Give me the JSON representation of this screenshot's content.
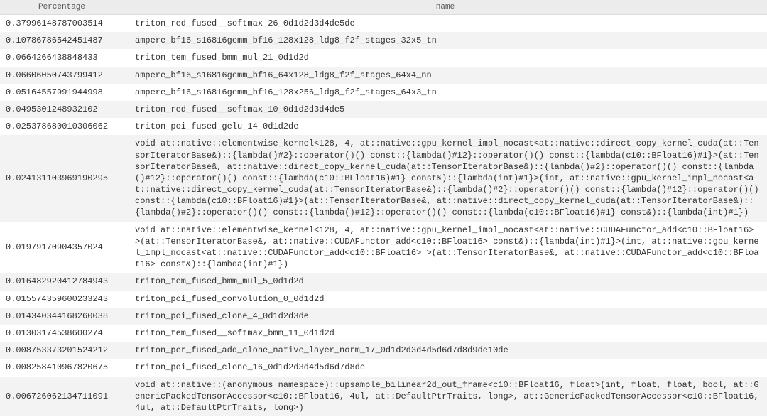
{
  "columns": {
    "percentage": "Percentage",
    "name": "name"
  },
  "rows": [
    {
      "percentage": "0.37996148787003514",
      "name": "triton_red_fused__softmax_26_0d1d2d3d4de5de"
    },
    {
      "percentage": "0.10786786542451487",
      "name": "ampere_bf16_s16816gemm_bf16_128x128_ldg8_f2f_stages_32x5_tn"
    },
    {
      "percentage": "0.0664266438848433",
      "name": "triton_tem_fused_bmm_mul_21_0d1d2d"
    },
    {
      "percentage": "0.06606050743799412",
      "name": "ampere_bf16_s16816gemm_bf16_64x128_ldg8_f2f_stages_64x4_nn"
    },
    {
      "percentage": "0.05164557991944998",
      "name": "ampere_bf16_s16816gemm_bf16_128x256_ldg8_f2f_stages_64x3_tn"
    },
    {
      "percentage": "0.0495301248932102",
      "name": "triton_red_fused__softmax_10_0d1d2d3d4de5"
    },
    {
      "percentage": "0.025378680010306062",
      "name": "triton_poi_fused_gelu_14_0d1d2de"
    },
    {
      "percentage": "0.024131103969190295",
      "name": "void at::native::elementwise_kernel<128, 4, at::native::gpu_kernel_impl_nocast<at::native::direct_copy_kernel_cuda(at::TensorIteratorBase&)::{lambda()#2}::operator()() const::{lambda()#12}::operator()() const::{lambda(c10::BFloat16)#1}>(at::TensorIteratorBase&, at::native::direct_copy_kernel_cuda(at::TensorIteratorBase&)::{lambda()#2}::operator()() const::{lambda()#12}::operator()() const::{lambda(c10::BFloat16)#1} const&)::{lambda(int)#1}>(int, at::native::gpu_kernel_impl_nocast<at::native::direct_copy_kernel_cuda(at::TensorIteratorBase&)::{lambda()#2}::operator()() const::{lambda()#12}::operator()() const::{lambda(c10::BFloat16)#1}>(at::TensorIteratorBase&, at::native::direct_copy_kernel_cuda(at::TensorIteratorBase&)::{lambda()#2}::operator()() const::{lambda()#12}::operator()() const::{lambda(c10::BFloat16)#1} const&)::{lambda(int)#1})"
    },
    {
      "percentage": "0.01979170904357024",
      "name": "void at::native::elementwise_kernel<128, 4, at::native::gpu_kernel_impl_nocast<at::native::CUDAFunctor_add<c10::BFloat16> >(at::TensorIteratorBase&, at::native::CUDAFunctor_add<c10::BFloat16> const&)::{lambda(int)#1}>(int, at::native::gpu_kernel_impl_nocast<at::native::CUDAFunctor_add<c10::BFloat16> >(at::TensorIteratorBase&, at::native::CUDAFunctor_add<c10::BFloat16> const&)::{lambda(int)#1})"
    },
    {
      "percentage": "0.016482920412784943",
      "name": "triton_tem_fused_bmm_mul_5_0d1d2d"
    },
    {
      "percentage": "0.015574359600233243",
      "name": "triton_poi_fused_convolution_0_0d1d2d"
    },
    {
      "percentage": "0.014340344168260038",
      "name": "triton_poi_fused_clone_4_0d1d2d3de"
    },
    {
      "percentage": "0.01303174538600274",
      "name": "triton_tem_fused__softmax_bmm_11_0d1d2d"
    },
    {
      "percentage": "0.008753373201524212",
      "name": "triton_per_fused_add_clone_native_layer_norm_17_0d1d2d3d4d5d6d7d8d9de10de"
    },
    {
      "percentage": "0.008258410967820675",
      "name": "triton_poi_fused_clone_16_0d1d2d3d4d5d6d7d8de"
    },
    {
      "percentage": "0.006726062134711091",
      "name": "void at::native::(anonymous namespace)::upsample_bilinear2d_out_frame<c10::BFloat16, float>(int, float, float, bool, at::GenericPackedTensorAccessor<c10::BFloat16, 4ul, at::DefaultPtrTraits, long>, at::GenericPackedTensorAccessor<c10::BFloat16, 4ul, at::DefaultPtrTraits, long>)"
    }
  ]
}
